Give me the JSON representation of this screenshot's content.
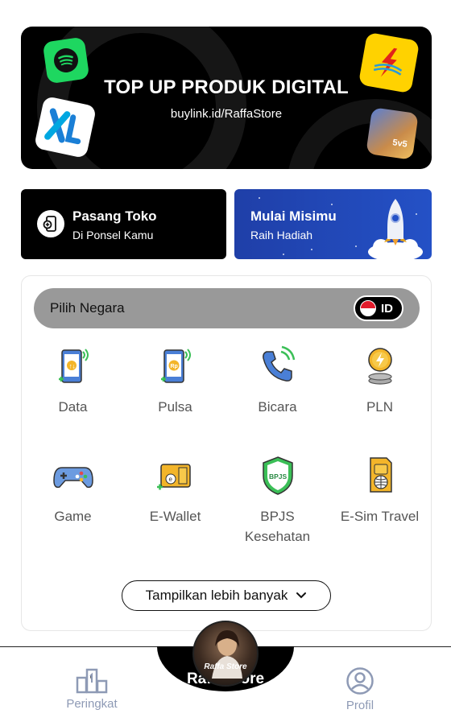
{
  "banner": {
    "title": "TOP UP PRODUK DIGITAL",
    "subtitle": "buylink.id/RaffaStore",
    "brands": [
      "spotify-logo",
      "xl-logo",
      "pln-logo",
      "mobile-legends-logo"
    ]
  },
  "promo": {
    "toko": {
      "title": "Pasang Toko",
      "subtitle": "Di Ponsel Kamu"
    },
    "misi": {
      "title": "Mulai Misimu",
      "subtitle": "Raih Hadiah"
    }
  },
  "country": {
    "label": "Pilih Negara",
    "code": "ID"
  },
  "services": [
    {
      "label": "Data",
      "icon": "phone-data-icon"
    },
    {
      "label": "Pulsa",
      "icon": "phone-pulsa-icon"
    },
    {
      "label": "Bicara",
      "icon": "phone-call-icon"
    },
    {
      "label": "PLN",
      "icon": "pln-coin-icon"
    },
    {
      "label": "Game",
      "icon": "gamepad-icon"
    },
    {
      "label": "E-Wallet",
      "icon": "wallet-icon"
    },
    {
      "label": "BPJS Kesehatan",
      "icon": "bpjs-shield-icon"
    },
    {
      "label": "E-Sim Travel",
      "icon": "esim-globe-icon"
    }
  ],
  "more_button": {
    "label": "Tampilkan lebih banyak"
  },
  "nav": {
    "left": {
      "label": "Peringkat"
    },
    "center": {
      "label": "RaffaStore",
      "avatar_text": "Raffa Store"
    },
    "right": {
      "label": "Profil"
    }
  },
  "colors": {
    "accent_blue": "#2451c6",
    "nav_gray": "#8e9ab5",
    "country_bar": "#999999"
  }
}
